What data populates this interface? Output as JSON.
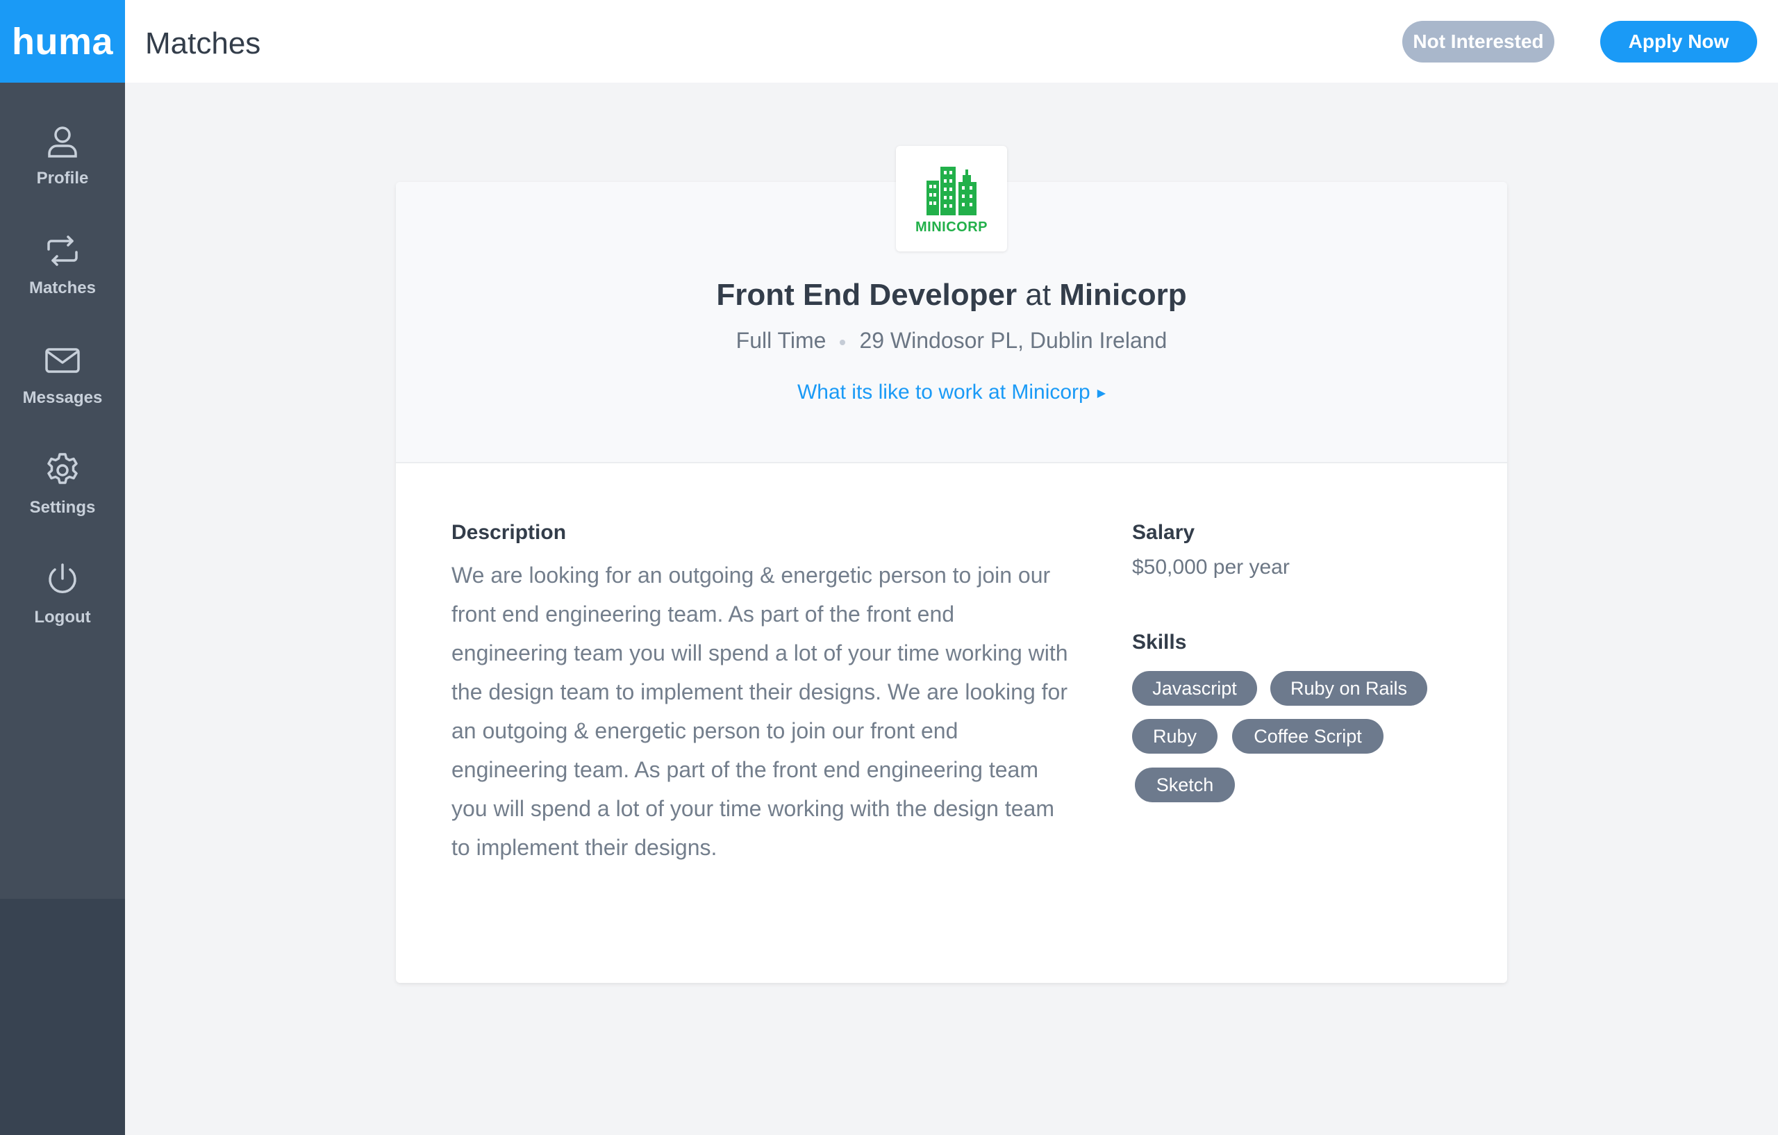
{
  "brand": "huma",
  "header": {
    "title": "Matches",
    "not_interested_label": "Not Interested",
    "apply_label": "Apply Now"
  },
  "sidebar": {
    "items": [
      {
        "label": "Profile",
        "icon": "user-icon"
      },
      {
        "label": "Matches",
        "icon": "swap-icon"
      },
      {
        "label": "Messages",
        "icon": "envelope-icon"
      },
      {
        "label": "Settings",
        "icon": "gear-icon"
      },
      {
        "label": "Logout",
        "icon": "power-icon"
      }
    ]
  },
  "job": {
    "logo_text": "MINICORP",
    "role": "Front End Developer",
    "at": "at",
    "company": "Minicorp",
    "type": "Full Time",
    "location": "29 Windosor PL, Dublin Ireland",
    "culture_link": "What its like to work at Minicorp",
    "description_heading": "Description",
    "description": "We are looking for an outgoing & energetic person to join our front end engineering team. As part of the front end engineering team you will spend a lot of your time working with the design team to implement their designs. We are looking for an outgoing & energetic person to join our front end engineering team. As part of the front end engineering team you will spend a lot of your time working with the design team to implement their designs.",
    "salary_heading": "Salary",
    "salary": "$50,000 per year",
    "skills_heading": "Skills",
    "skills": [
      "Javascript",
      "Ruby on Rails",
      "Ruby",
      "Coffee Script",
      "Sketch"
    ]
  },
  "colors": {
    "accent": "#1a9af6",
    "sidebar": "#434d5a",
    "logo_green": "#22b04a",
    "tag": "#6d7a8d"
  }
}
